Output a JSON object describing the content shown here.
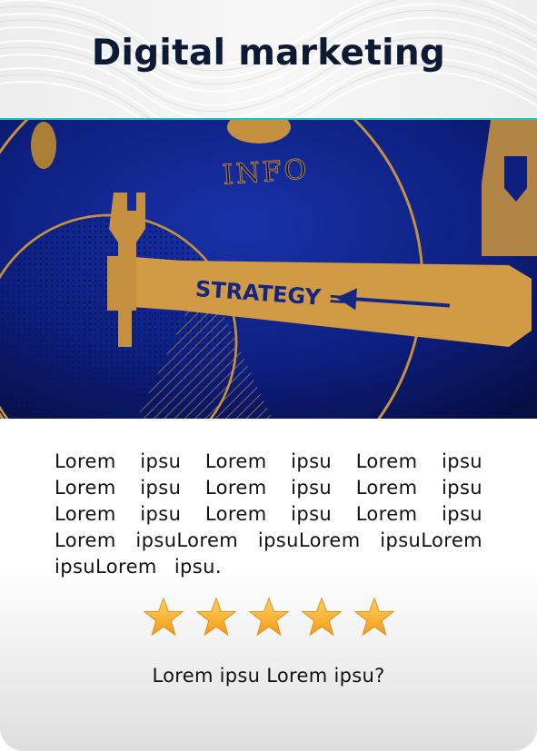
{
  "header": {
    "title": "Digital marketing"
  },
  "hero_image": {
    "description_labels": [
      "INFO",
      "STRATEGY ="
    ]
  },
  "content": {
    "paragraph": "Lorem ipsu Lorem ipsu Lorem ipsu Lorem ipsu Lorem ipsu Lorem ipsu Lorem ipsu Lorem ipsu Lorem ipsu Lorem ipsuLorem ipsuLorem ipsuLorem ipsuLorem ipsu.",
    "rating": {
      "value": 5,
      "max": 5
    },
    "question": "Lorem ipsu Lorem ipsu?"
  },
  "colors": {
    "title": "#0c1a33",
    "star": "#f7b733",
    "hero_blue": "#0e1f78",
    "hero_gold": "#e2a94a"
  }
}
